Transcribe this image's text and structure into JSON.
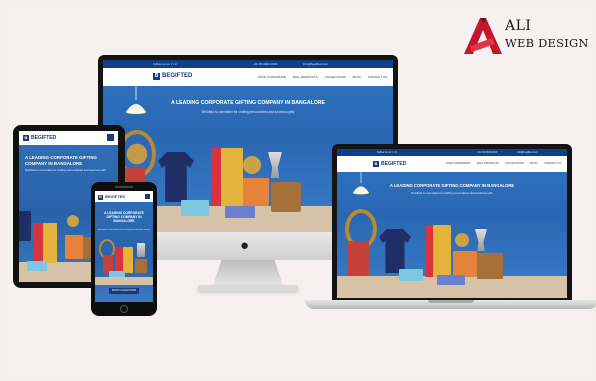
{
  "brand": {
    "line1": "ALI",
    "line2": "WEB DESIGN",
    "accent_color": "#c0172e"
  },
  "website": {
    "logo_text": "BEGIFTED",
    "topbar_left": "Follow us on: f t in",
    "topbar_right": [
      "+91 00 0000 0000",
      "info@begifted.com"
    ],
    "nav_items": [
      "GOLD CORPORATE",
      "BALL PRODUCTS",
      "COLLECTIONS",
      "BLOG",
      "CONTACT US"
    ],
    "hero_title": "A LEADING CORPORATE GIFTING COMPANY IN BANGALORE",
    "hero_subtitle": "BeGifted is committed for crafting personalized and luxurious gifts",
    "shop_button": "SHOP COLLECTIONS",
    "colors": {
      "topbar": "#0f3f86",
      "hero": "#2f74c0",
      "logo": "#173c7a"
    }
  },
  "devices": [
    "desktop-monitor",
    "laptop",
    "tablet",
    "phone"
  ],
  "icons": {
    "apple_logo": "apple-icon",
    "lamp": "pendant-lamp-icon"
  }
}
